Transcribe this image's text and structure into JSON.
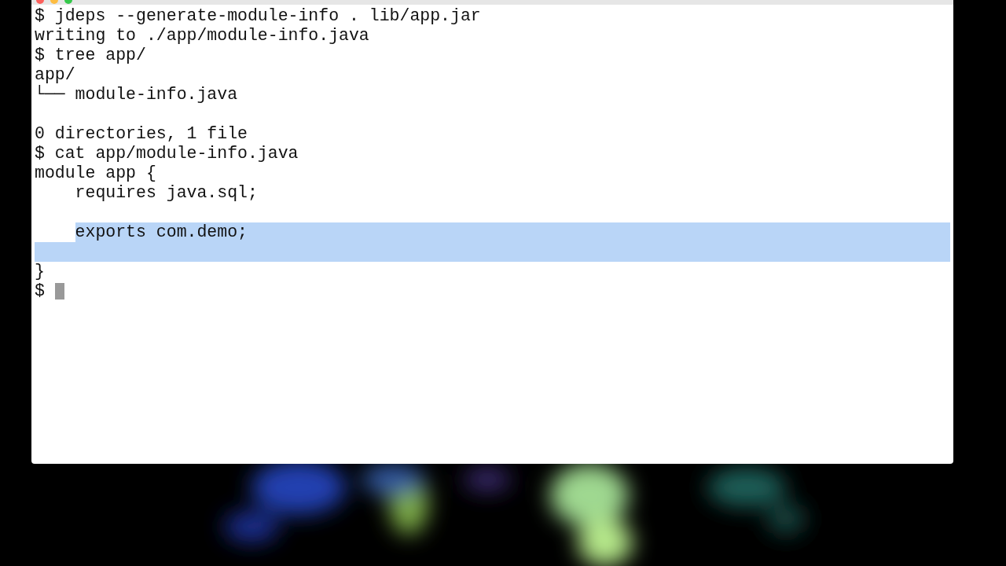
{
  "terminal": {
    "lines": [
      {
        "text": "$ jdeps --generate-module-info . lib/app.jar",
        "selected": false
      },
      {
        "text": "writing to ./app/module-info.java",
        "selected": false
      },
      {
        "text": "$ tree app/",
        "selected": false
      },
      {
        "text": "app/",
        "selected": false
      },
      {
        "text": "└── module-info.java",
        "selected": false
      },
      {
        "selected": false
      },
      {
        "text": "0 directories, 1 file",
        "selected": false
      },
      {
        "text": "$ cat app/module-info.java",
        "selected": false
      },
      {
        "text": "module app {",
        "selected": false
      },
      {
        "text": "    requires java.sql;",
        "selected": false
      },
      {
        "selected": false
      },
      {
        "text": "    exports com.demo;",
        "selected": true
      },
      {
        "selected": true
      },
      {
        "text": "}",
        "selected": false
      },
      {
        "text": "$",
        "selected": false,
        "cursor": true
      }
    ]
  }
}
